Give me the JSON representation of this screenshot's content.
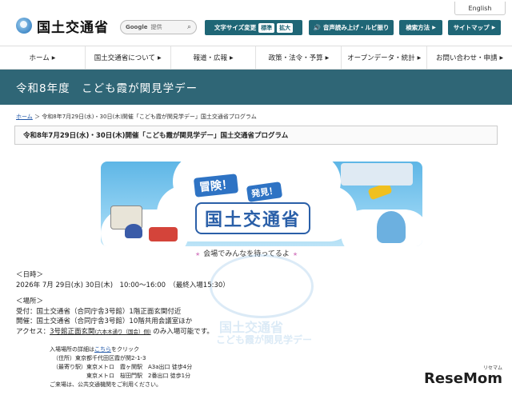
{
  "header": {
    "language_button": "English",
    "logo_text": "国土交通省",
    "search": {
      "brand": "Google",
      "placeholder": "提供"
    },
    "text_size_label": "文字サイズ変更",
    "text_size_standard": "標準",
    "text_size_large": "拡大",
    "read_aloud": "音声読み上げ・ルビ振り",
    "search_method": "検索方法",
    "sitemap": "サイトマップ"
  },
  "nav": [
    {
      "label": "ホーム"
    },
    {
      "label": "国土交通省について"
    },
    {
      "label": "報道・広報"
    },
    {
      "label": "政策・法令・予算"
    },
    {
      "label": "オープンデータ・統計"
    },
    {
      "label": "お問い合わせ・申請"
    }
  ],
  "banner": {
    "title": "令和8年度　こども霞が関見学デー"
  },
  "breadcrumb": {
    "home": "ホーム",
    "current": "＞ 令和8年7月29日(水)・30日(木)開催「こども霞が関見学デー」国土交通省プログラム"
  },
  "page_title": "令和8年7月29日(水)・30日(木)開催「こども霞が関見学デー」国土交通省プログラム",
  "hero": {
    "bubble1": "冒険！",
    "bubble2": "発見！",
    "sign": "国土交通省",
    "tagline": "会場でみんなを待ってるよ"
  },
  "watermark": {
    "line1": "国土交通省",
    "line2": "こども霞が関見学デー"
  },
  "schedule": {
    "heading": "＜日時＞",
    "text": "2026年 7月 29日(水) 30日(木)　10:00～16:00　（最終入場15:30）"
  },
  "venue": {
    "heading": "＜場所＞",
    "reception": "受付：国土交通省（合同庁舎3号館）1階正面玄関付近",
    "hall": "開催：国土交通省（合同庁舎3号館）10階共用会議室ほか",
    "access_prefix": "アクセス：",
    "access_main": "3号館正面玄関",
    "access_small": "(六本木通り（国会）側)",
    "access_suffix": " のみ入場可能です。",
    "details_prefix": "入場場所の詳細は",
    "details_link": "こちら",
    "details_suffix": "をクリック",
    "address": "（住所）東京都千代田区霞が関2-1-3",
    "station1": "（最寄り駅）東京メトロ　霞ヶ関駅　A3a出口 徒歩4分",
    "station2": "　　　　　　東京メトロ　桜田門駅　2番出口 徒歩1分",
    "note": "ご来場は、公共交通機関をご利用ください。"
  },
  "watermark_brand": {
    "name": "ReseMom",
    "kana": "リセマム"
  }
}
